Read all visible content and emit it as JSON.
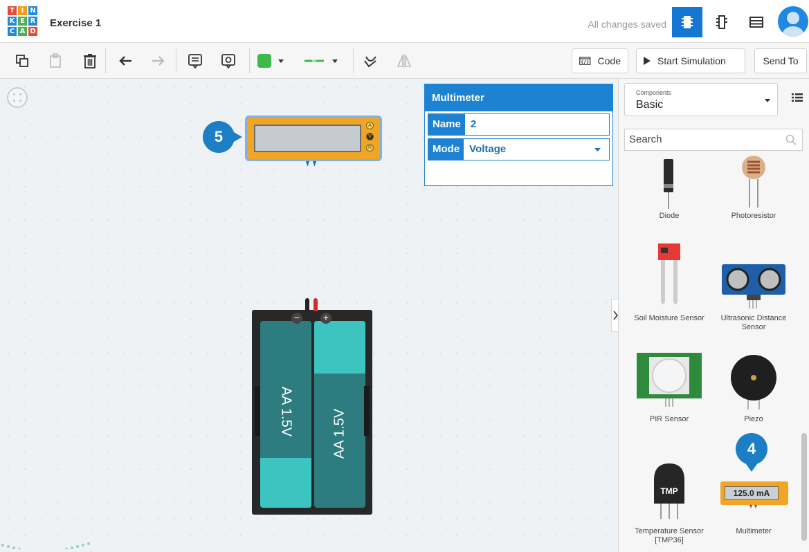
{
  "app": {
    "logo_letters": [
      "T",
      "I",
      "N",
      "K",
      "E",
      "R",
      "C",
      "A",
      "D"
    ],
    "project_title": "Exercise 1",
    "save_status": "All changes saved"
  },
  "toolbar": {
    "code_label": "Code",
    "simulate_label": "Start Simulation",
    "send_label": "Send To",
    "fill_color": "#3cba4d",
    "wire_color": "#3cba4d"
  },
  "canvas": {
    "badge_5": "5",
    "badge_4": "4",
    "battery_cell_1": "AA 1.5V",
    "battery_cell_2": "AA 1.5V",
    "terminal_minus": "−",
    "terminal_plus": "+"
  },
  "props": {
    "title": "Multimeter",
    "name_label": "Name",
    "name_value": "2",
    "mode_label": "Mode",
    "mode_value": "Voltage"
  },
  "sidebar": {
    "components_small": "Components",
    "components_value": "Basic",
    "search_placeholder": "Search",
    "items": [
      {
        "name": "Diode"
      },
      {
        "name": "Photoresistor"
      },
      {
        "name": "Soil Moisture Sensor"
      },
      {
        "name": "Ultrasonic Distance Sensor"
      },
      {
        "name": "PIR Sensor"
      },
      {
        "name": "Piezo"
      },
      {
        "name": "Temperature Sensor [TMP36]"
      },
      {
        "name": "Multimeter"
      }
    ],
    "multimeter_reading": "125.0 mA",
    "tmp_label": "TMP"
  },
  "colors": {
    "accent": "#1c82d1",
    "battery_cell": "#2d7d80",
    "battery_cap": "#3ec4c0",
    "meter_body": "#f0a526"
  }
}
